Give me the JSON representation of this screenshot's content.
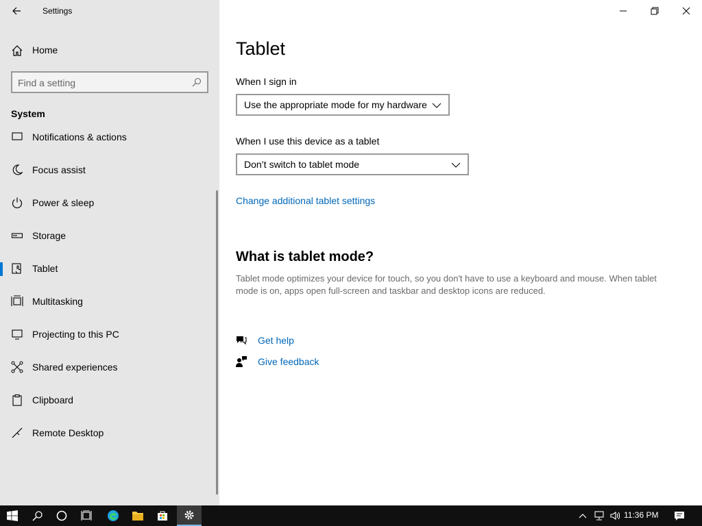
{
  "window": {
    "title": "Settings",
    "controls": [
      "minimize-icon",
      "restore-icon",
      "close-icon"
    ]
  },
  "sidebar": {
    "home_label": "Home",
    "search_placeholder": "Find a setting",
    "section_title": "System",
    "items": [
      {
        "label": "Notifications & actions",
        "icon": "notification-icon"
      },
      {
        "label": "Focus assist",
        "icon": "moon-icon"
      },
      {
        "label": "Power & sleep",
        "icon": "power-icon"
      },
      {
        "label": "Storage",
        "icon": "storage-icon"
      },
      {
        "label": "Tablet",
        "icon": "tablet-icon",
        "selected": true
      },
      {
        "label": "Multitasking",
        "icon": "multitasking-icon"
      },
      {
        "label": "Projecting to this PC",
        "icon": "projecting-icon"
      },
      {
        "label": "Shared experiences",
        "icon": "shared-icon"
      },
      {
        "label": "Clipboard",
        "icon": "clipboard-icon"
      },
      {
        "label": "Remote Desktop",
        "icon": "remote-desktop-icon"
      }
    ]
  },
  "main": {
    "title": "Tablet",
    "sign_in_label": "When I sign in",
    "sign_in_value": "Use the appropriate mode for my hardware",
    "tablet_use_label": "When I use this device as a tablet",
    "tablet_use_value": "Don’t switch to tablet mode",
    "change_link": "Change additional tablet settings",
    "what_title": "What is tablet mode?",
    "what_desc": "Tablet mode optimizes your device for touch, so you don't have to use a keyboard and mouse. When tablet mode is on, apps open full-screen and taskbar and desktop icons are reduced.",
    "get_help": "Get help",
    "give_feedback": "Give feedback"
  },
  "taskbar": {
    "clock": "11:36 PM",
    "colors": {
      "background": "#101010",
      "accent": "#76b9ed"
    }
  },
  "colors": {
    "accent": "#0078d4",
    "link": "#0067b8",
    "sidebar_bg": "#e6e6e6"
  }
}
